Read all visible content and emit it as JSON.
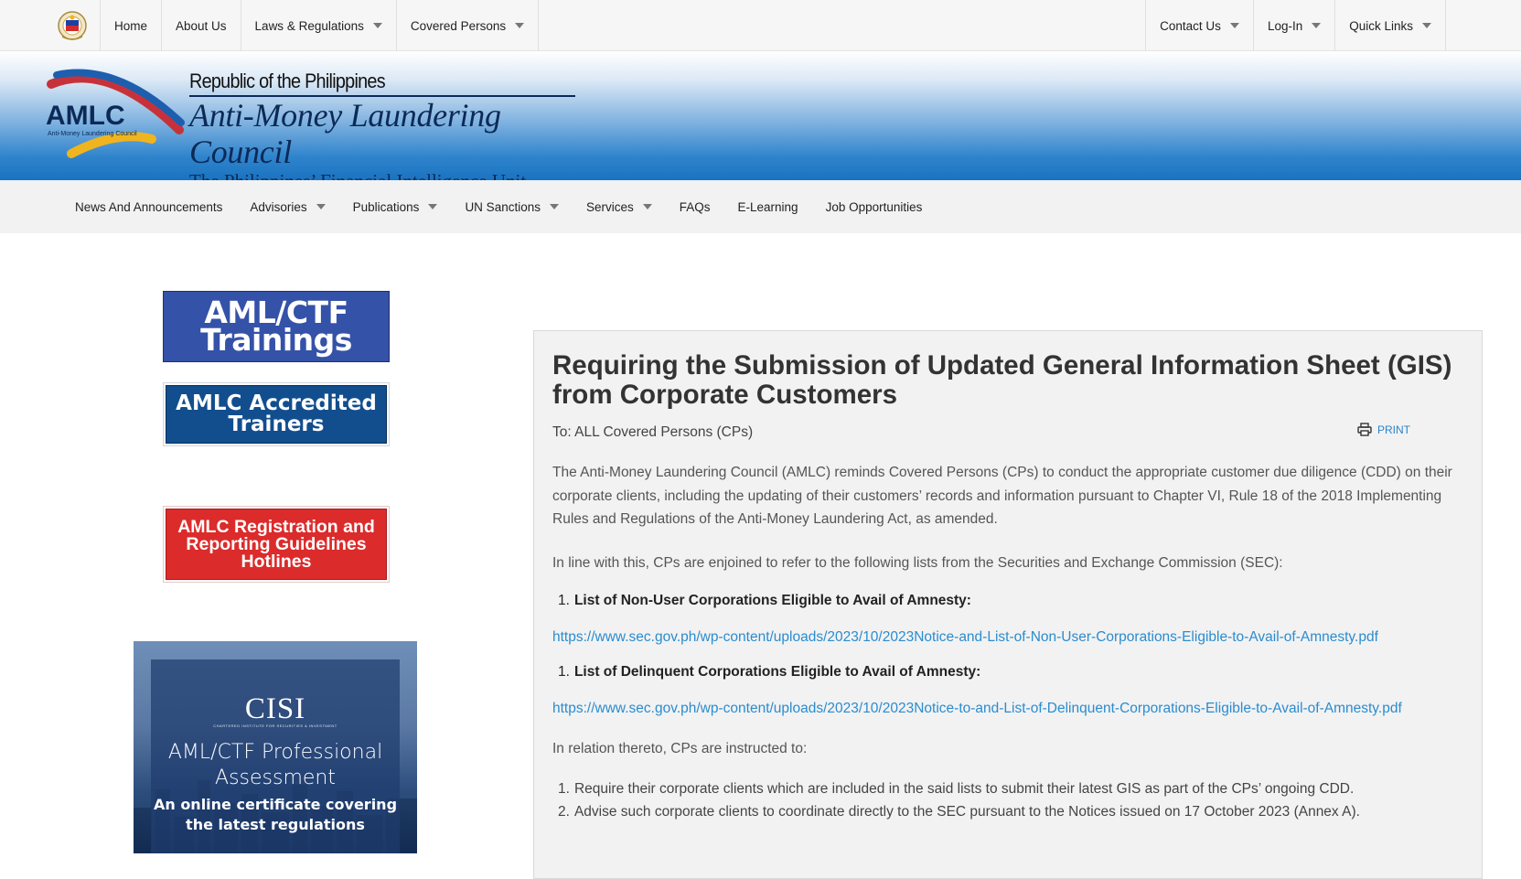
{
  "topnav": {
    "left": [
      {
        "label": "Home",
        "dropdown": false
      },
      {
        "label": "About Us",
        "dropdown": false
      },
      {
        "label": "Laws & Regulations",
        "dropdown": true
      },
      {
        "label": "Covered Persons",
        "dropdown": true
      }
    ],
    "right": [
      {
        "label": "Contact Us",
        "dropdown": true
      },
      {
        "label": "Log-In",
        "dropdown": true
      },
      {
        "label": "Quick Links",
        "dropdown": true
      }
    ]
  },
  "banner": {
    "logo_letters": "AMLC",
    "logo_caption": "Anti-Money Laundering Council",
    "republic": "Republic of the Philippines",
    "org_name": "Anti-Money Laundering Council",
    "tagline": "The Philippines’ Financial Intelligence Unit"
  },
  "mainnav": [
    {
      "label": "News And Announcements",
      "dropdown": false
    },
    {
      "label": "Advisories",
      "dropdown": true
    },
    {
      "label": "Publications",
      "dropdown": true
    },
    {
      "label": "UN Sanctions",
      "dropdown": true
    },
    {
      "label": "Services",
      "dropdown": true
    },
    {
      "label": "FAQs",
      "dropdown": false
    },
    {
      "label": "E-Learning",
      "dropdown": false
    },
    {
      "label": "Job Opportunities",
      "dropdown": false
    }
  ],
  "sidebar": {
    "trainings": {
      "line1": "AML/CTF",
      "line2": "Trainings"
    },
    "trainers": {
      "line1": "AMLC Accredited",
      "line2": "Trainers"
    },
    "hotlines": {
      "line1": "AMLC Registration and",
      "line2": "Reporting Guidelines",
      "line3": "Hotlines"
    },
    "cisi": {
      "logo": "CISI",
      "logo_small": "CHARTERED INSTITUTE FOR SECURITIES & INVESTMENT",
      "title1": "AML/CTF Professional",
      "title2": "Assessment",
      "tag1": "An online certificate covering",
      "tag2": "the latest regulations"
    }
  },
  "article": {
    "title": "Requiring the Submission of Updated General Information Sheet (GIS) from Corporate Customers",
    "to": "To: ALL Covered Persons (CPs)",
    "print": "PRINT",
    "para1": "The Anti-Money Laundering Council (AMLC) reminds Covered Persons (CPs) to conduct the appropriate customer due diligence (CDD) on their corporate clients, including the updating of their customers’ records and information pursuant to Chapter VI, Rule 18 of the 2018 Implementing Rules and Regulations of the Anti-Money Laundering Act, as amended.",
    "para2": "In line with this, CPs are enjoined to refer to the following lists from the Securities and Exchange Commission (SEC):",
    "list1": {
      "num": "1.",
      "label": "List of Non-User Corporations Eligible to Avail of Amnesty:"
    },
    "link1": "https://www.sec.gov.ph/wp-content/uploads/2023/10/2023Notice-and-List-of-Non-User-Corporations-Eligible-to-Avail-of-Amnesty.pdf",
    "list2": {
      "num": "1.",
      "label": "List of Delinquent Corporations Eligible to Avail of Amnesty:"
    },
    "link2": "https://www.sec.gov.ph/wp-content/uploads/2023/10/2023Notice-to-and-List-of-Delinquent-Corporations-Eligible-to-Avail-of-Amnesty.pdf",
    "para3": "In relation thereto, CPs are instructed to:",
    "instructions": [
      {
        "num": "1.",
        "text": "Require their corporate clients which are included in the said lists to submit their latest GIS as part of the CPs’ ongoing CDD."
      },
      {
        "num": "2.",
        "text": "Advise such corporate clients to coordinate directly to the SEC pursuant to the Notices issued on 17 October 2023 (Annex A)."
      }
    ]
  }
}
